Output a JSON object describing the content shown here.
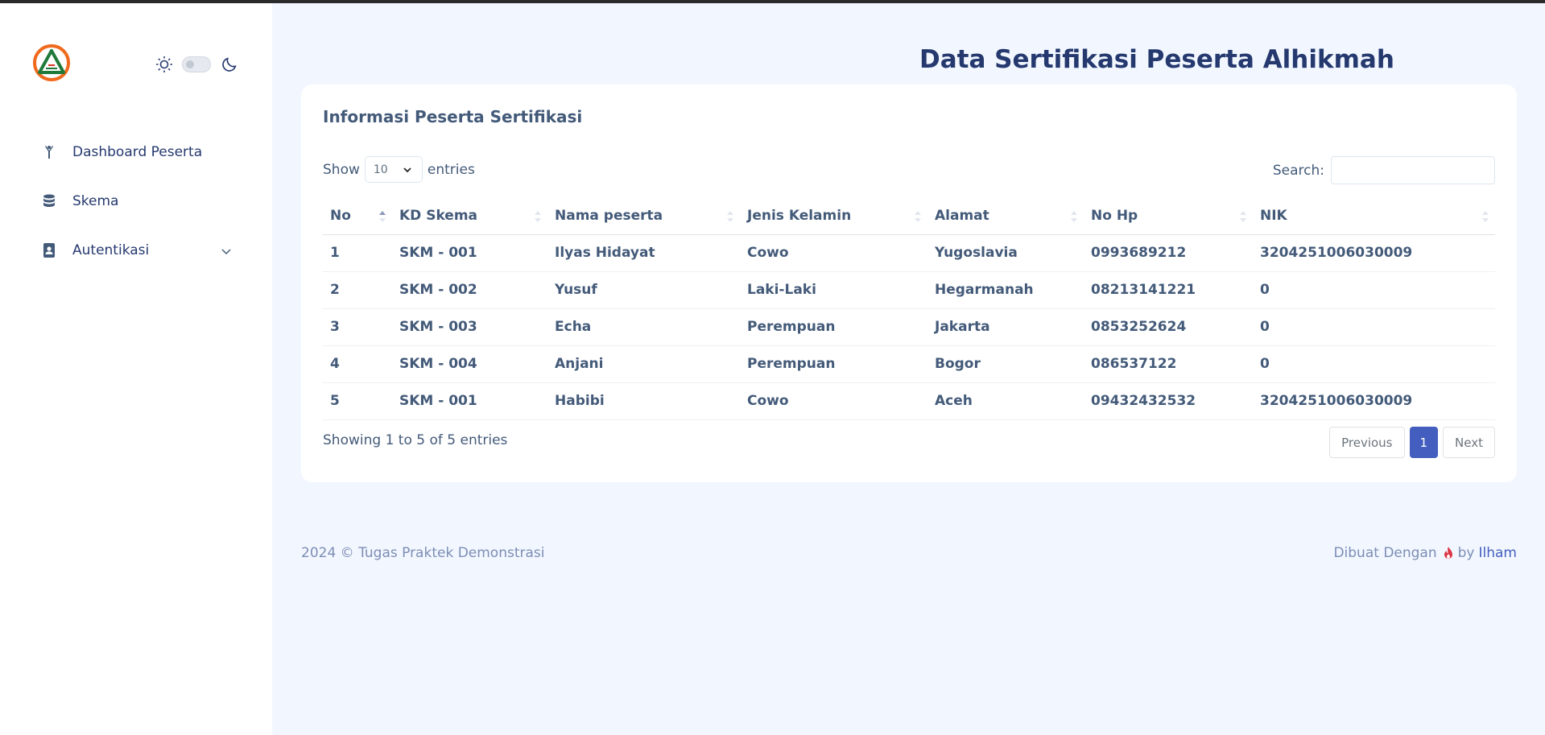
{
  "sidebar": {
    "menu": [
      {
        "label": "Dashboard Peserta",
        "icon": "person-icon"
      },
      {
        "label": "Skema",
        "icon": "database-icon"
      },
      {
        "label": "Autentikasi",
        "icon": "id-badge-icon",
        "has_submenu": true
      }
    ]
  },
  "header": {
    "title": "Data Sertifikasi Peserta Alhikmah"
  },
  "card": {
    "title": "Informasi Peserta Sertifikasi",
    "show_label": "Show",
    "entries_value": "10",
    "entries_label": "entries",
    "search_label": "Search:",
    "search_value": "",
    "columns": [
      "No",
      "KD Skema",
      "Nama peserta",
      "Jenis Kelamin",
      "Alamat",
      "No Hp",
      "NIK"
    ],
    "rows": [
      [
        "1",
        "SKM - 001",
        "Ilyas Hidayat",
        "Cowo",
        "Yugoslavia",
        "0993689212",
        "3204251006030009"
      ],
      [
        "2",
        "SKM - 002",
        "Yusuf",
        "Laki-Laki",
        "Hegarmanah",
        "08213141221",
        "0"
      ],
      [
        "3",
        "SKM - 003",
        "Echa",
        "Perempuan",
        "Jakarta",
        "0853252624",
        "0"
      ],
      [
        "4",
        "SKM - 004",
        "Anjani",
        "Perempuan",
        "Bogor",
        "086537122",
        "0"
      ],
      [
        "5",
        "SKM - 001",
        "Habibi",
        "Cowo",
        "Aceh",
        "09432432532",
        "3204251006030009"
      ]
    ],
    "info": "Showing 1 to 5 of 5 entries",
    "pagination": {
      "previous": "Previous",
      "current": "1",
      "next": "Next"
    }
  },
  "footer": {
    "left": "2024 © Tugas Praktek Demonstrasi",
    "made_with": "Dibuat Dengan",
    "by": "by",
    "author": "Ilham"
  },
  "colors": {
    "primary": "#435ebe",
    "text": "#25396f",
    "background": "#f2f7ff"
  }
}
